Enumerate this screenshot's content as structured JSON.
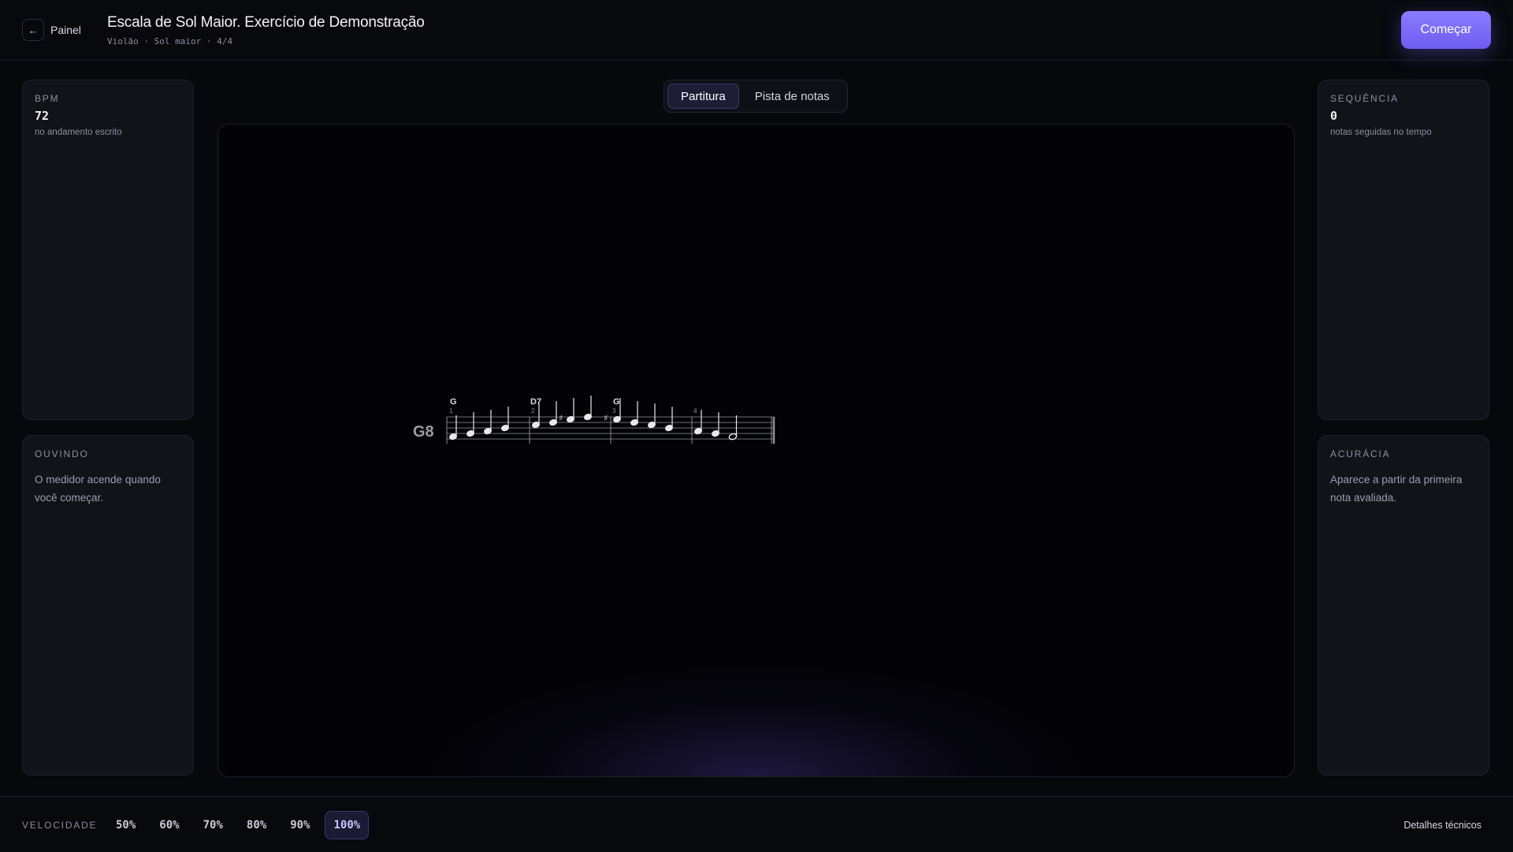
{
  "header": {
    "back_label": "Painel",
    "title": "Escala de Sol Maior. Exercício de Demonstração",
    "subtitle": "Violão · Sol maior · 4/4",
    "start_label": "Começar"
  },
  "panels": {
    "bpm": {
      "label": "BPM",
      "value": "72",
      "sub": "no andamento escrito"
    },
    "listening": {
      "label": "OUVINDO",
      "text": "O medidor acende quando você começar."
    },
    "streak": {
      "label": "SEQUÊNCIA",
      "value": "0",
      "sub": "notas seguidas no tempo"
    },
    "accuracy": {
      "label": "ACURÁCIA",
      "text": "Aparece a partir da primeira nota avaliada."
    }
  },
  "tabs": [
    {
      "label": "Partitura",
      "active": true
    },
    {
      "label": "Pista de notas",
      "active": false
    }
  ],
  "score": {
    "clef": "G8",
    "measures": [
      {
        "number": "1",
        "chord": "G"
      },
      {
        "number": "2",
        "chord": "D7"
      },
      {
        "number": "3",
        "chord": "G"
      },
      {
        "number": "4",
        "chord": ""
      }
    ]
  },
  "footer": {
    "speed_label": "VELOCIDADE",
    "speeds": [
      {
        "label": "50%",
        "active": false
      },
      {
        "label": "60%",
        "active": false
      },
      {
        "label": "70%",
        "active": false
      },
      {
        "label": "80%",
        "active": false
      },
      {
        "label": "90%",
        "active": false
      },
      {
        "label": "100%",
        "active": true
      }
    ],
    "tech_label": "Detalhes técnicos"
  }
}
